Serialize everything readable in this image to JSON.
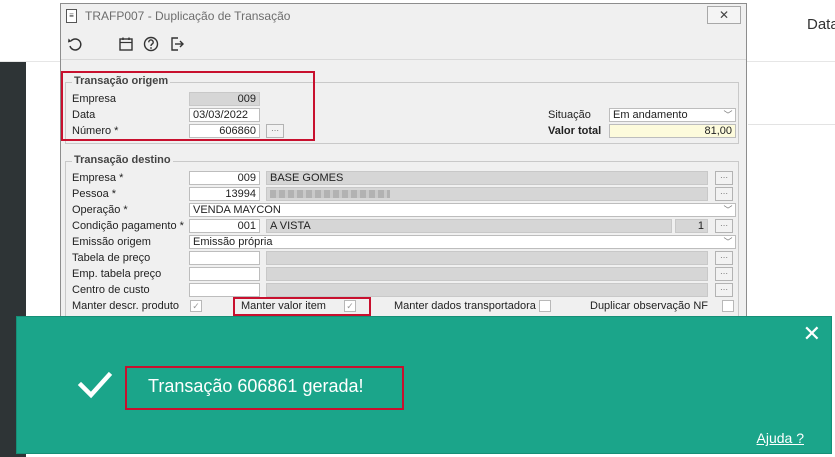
{
  "background": {
    "right_text": "Data"
  },
  "window": {
    "title": "TRAFP007 - Duplicação de Transação",
    "close_glyph": "✕",
    "toolbar": [
      "undo-icon",
      "calendar-icon",
      "help-icon",
      "exit-icon"
    ]
  },
  "origem": {
    "title": "Transação origem",
    "empresa_label": "Empresa",
    "empresa_value": "009",
    "data_label": "Data",
    "data_value": "03/03/2022",
    "numero_label": "Número *",
    "numero_value": "606860",
    "situacao_label": "Situação",
    "situacao_value": "Em andamento",
    "valor_total_label": "Valor total",
    "valor_total_value": "81,00"
  },
  "destino": {
    "title": "Transação destino",
    "empresa_label": "Empresa *",
    "empresa_code": "009",
    "empresa_name": "BASE GOMES",
    "pessoa_label": "Pessoa *",
    "pessoa_code": "13994",
    "operacao_label": "Operação *",
    "operacao_value": "VENDA MAYCON",
    "condicao_label": "Condição pagamento *",
    "condicao_code": "001",
    "condicao_name": "A VISTA",
    "condicao_parcelas": "1",
    "emissao_label": "Emissão origem",
    "emissao_value": "Emissão própria",
    "tabela_label": "Tabela de preço",
    "emp_tabela_label": "Emp. tabela preço",
    "centro_label": "Centro de custo",
    "manter_descr_label": "Manter descr. produto",
    "manter_valor_label": "Manter valor item",
    "manter_dados_label": "Manter dados transportadora",
    "duplicar_obs_label": "Duplicar observação NF"
  },
  "toast": {
    "message": "Transação 606861 gerada!",
    "help_link": "Ajuda ?",
    "close_glyph": "✕",
    "accent": "#1ba58a"
  },
  "colors": {
    "highlight": "#c8102e",
    "window_bg": "#f0f0f0"
  }
}
